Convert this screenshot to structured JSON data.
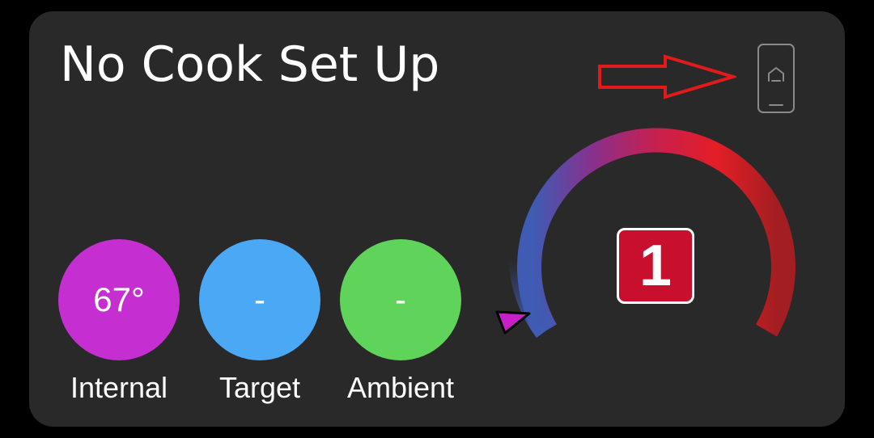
{
  "card": {
    "title": "No Cook Set Up"
  },
  "probe_status": {
    "icon": "probe-home-icon"
  },
  "readings": [
    {
      "label": "Internal",
      "value": "67°",
      "color": "#c52fd1"
    },
    {
      "label": "Target",
      "value": "-",
      "color": "#4ba8f5"
    },
    {
      "label": "Ambient",
      "value": "-",
      "color": "#5fd35a"
    }
  ],
  "gauge": {
    "badge_value": "1",
    "badge_color": "#c8102e",
    "gradient_start": "#3f5bb4",
    "gradient_mid": "#a02a80",
    "gradient_end": "#e41e26",
    "gradient_tail": "#a31e22",
    "pointer_color": "#c820c8"
  },
  "annotation": {
    "arrow_color": "#e11b1b",
    "icon": "arrow-right-icon"
  }
}
